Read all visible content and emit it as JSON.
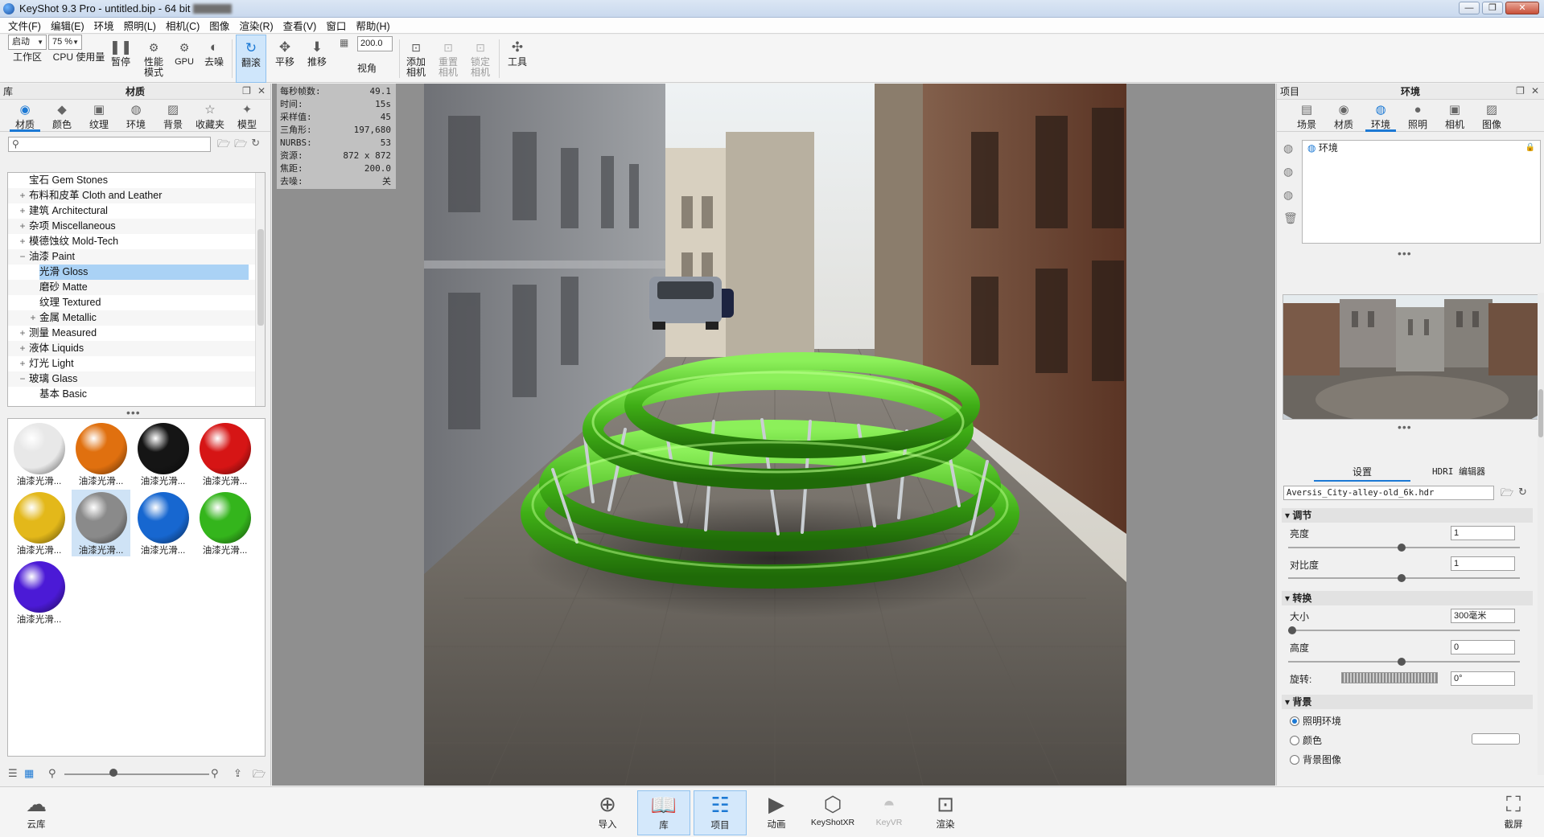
{
  "window": {
    "title": "KeyShot 9.3 Pro  - untitled.bip  - 64 bit",
    "controls": [
      "—",
      "❐",
      "✕"
    ]
  },
  "menu": [
    "文件(F)",
    "编辑(E)",
    "环境",
    "照明(L)",
    "相机(C)",
    "图像",
    "渲染(R)",
    "查看(V)",
    "窗口",
    "帮助(H)"
  ],
  "toolbar": {
    "workspace_select": "启动",
    "workspace_label": "工作区",
    "cpu_select": "75 %",
    "cpu_label": "CPU 使用量",
    "pause": "暂停",
    "perf_mode": "性能\n模式",
    "gpu": "GPU",
    "denoise": "去噪",
    "tumble": "翻滚",
    "pan": "平移",
    "dolly": "推移",
    "fov_value": "200.0",
    "fov_label": "视角",
    "add_camera": "添加\n相机",
    "reset_camera": "重置\n相机",
    "lock_camera": "锁定\n相机",
    "tools": "工具"
  },
  "left_panel": {
    "header_left": "库",
    "header_title": "材质",
    "tabs": [
      {
        "label": "材质",
        "icon": "material-icon"
      },
      {
        "label": "颜色",
        "icon": "color-icon"
      },
      {
        "label": "纹理",
        "icon": "texture-icon"
      },
      {
        "label": "环境",
        "icon": "environment-icon"
      },
      {
        "label": "背景",
        "icon": "background-icon"
      },
      {
        "label": "收藏夹",
        "icon": "favorites-icon"
      },
      {
        "label": "模型",
        "icon": "model-icon"
      }
    ],
    "search_placeholder": "",
    "tree": [
      {
        "label": "宝石 Gem Stones",
        "exp": "",
        "indent": 0
      },
      {
        "label": "布料和皮革 Cloth and Leather",
        "exp": "+",
        "indent": 0
      },
      {
        "label": "建筑 Architectural",
        "exp": "+",
        "indent": 0
      },
      {
        "label": "杂项 Miscellaneous",
        "exp": "+",
        "indent": 0
      },
      {
        "label": "模德蚀纹 Mold-Tech",
        "exp": "+",
        "indent": 0
      },
      {
        "label": "油漆 Paint",
        "exp": "−",
        "indent": 0
      },
      {
        "label": "光滑 Gloss",
        "exp": "",
        "indent": 1,
        "selected": true
      },
      {
        "label": "磨砂 Matte",
        "exp": "",
        "indent": 1
      },
      {
        "label": "纹理 Textured",
        "exp": "",
        "indent": 1
      },
      {
        "label": "金属 Metallic",
        "exp": "+",
        "indent": 1
      },
      {
        "label": "测量 Measured",
        "exp": "+",
        "indent": 0
      },
      {
        "label": "液体 Liquids",
        "exp": "+",
        "indent": 0
      },
      {
        "label": "灯光 Light",
        "exp": "+",
        "indent": 0
      },
      {
        "label": "玻璃 Glass",
        "exp": "−",
        "indent": 0
      },
      {
        "label": "基本 Basic",
        "exp": "",
        "indent": 1
      }
    ],
    "materials": [
      {
        "label": "油漆光滑...",
        "color": "#e8e8e8"
      },
      {
        "label": "油漆光滑...",
        "color": "#e0700f"
      },
      {
        "label": "油漆光滑...",
        "color": "#151515"
      },
      {
        "label": "油漆光滑...",
        "color": "#d61515"
      },
      {
        "label": "油漆光滑...",
        "color": "#e3b81a"
      },
      {
        "label": "油漆光滑...",
        "color": "#8a8a8a",
        "selected": true
      },
      {
        "label": "油漆光滑...",
        "color": "#1767d0"
      },
      {
        "label": "油漆光滑...",
        "color": "#34b51c"
      },
      {
        "label": "油漆光滑...",
        "color": "#4b1ad6"
      }
    ]
  },
  "hud": [
    {
      "k": "每秒帧数:",
      "v": "49.1"
    },
    {
      "k": "时间:",
      "v": "15s"
    },
    {
      "k": "采样值:",
      "v": "45"
    },
    {
      "k": "三角形:",
      "v": "197,680"
    },
    {
      "k": "NURBS:",
      "v": "53"
    },
    {
      "k": "资源:",
      "v": "872 x 872"
    },
    {
      "k": "焦距:",
      "v": "200.0"
    },
    {
      "k": "去噪:",
      "v": "关"
    }
  ],
  "right_panel": {
    "header_left": "项目",
    "header_title": "环境",
    "tabs": [
      {
        "label": "场景",
        "icon": "scene-icon"
      },
      {
        "label": "材质",
        "icon": "material-icon"
      },
      {
        "label": "环境",
        "icon": "environment-icon"
      },
      {
        "label": "照明",
        "icon": "lighting-icon"
      },
      {
        "label": "相机",
        "icon": "camera-icon"
      },
      {
        "label": "图像",
        "icon": "image-icon"
      }
    ],
    "env_item": "环境",
    "subtabs": [
      "设置",
      "HDRI 编辑器"
    ],
    "hdri_file": "Aversis_City-alley-old_6k.hdr",
    "sections": {
      "adjust": "调节",
      "transform": "转换",
      "background": "背景"
    },
    "props": {
      "brightness_label": "亮度",
      "brightness_value": "1",
      "contrast_label": "对比度",
      "contrast_value": "1",
      "size_label": "大小",
      "size_value": "300毫米",
      "height_label": "高度",
      "height_value": "0",
      "rotation_label": "旋转:",
      "rotation_value": "0°"
    },
    "background_options": [
      "照明环境",
      "颜色",
      "背景图像"
    ]
  },
  "bottom": {
    "cloud": "云库",
    "import": "导入",
    "library": "库",
    "project": "项目",
    "animation": "动画",
    "keyshotxr": "KeyShotXR",
    "keyvr": "KeyVR",
    "render": "渲染",
    "screenshot": "截屏"
  },
  "colors": {
    "accent": "#1c79d4",
    "selection": "#aad2f5",
    "ring_green": "#3fae16"
  }
}
